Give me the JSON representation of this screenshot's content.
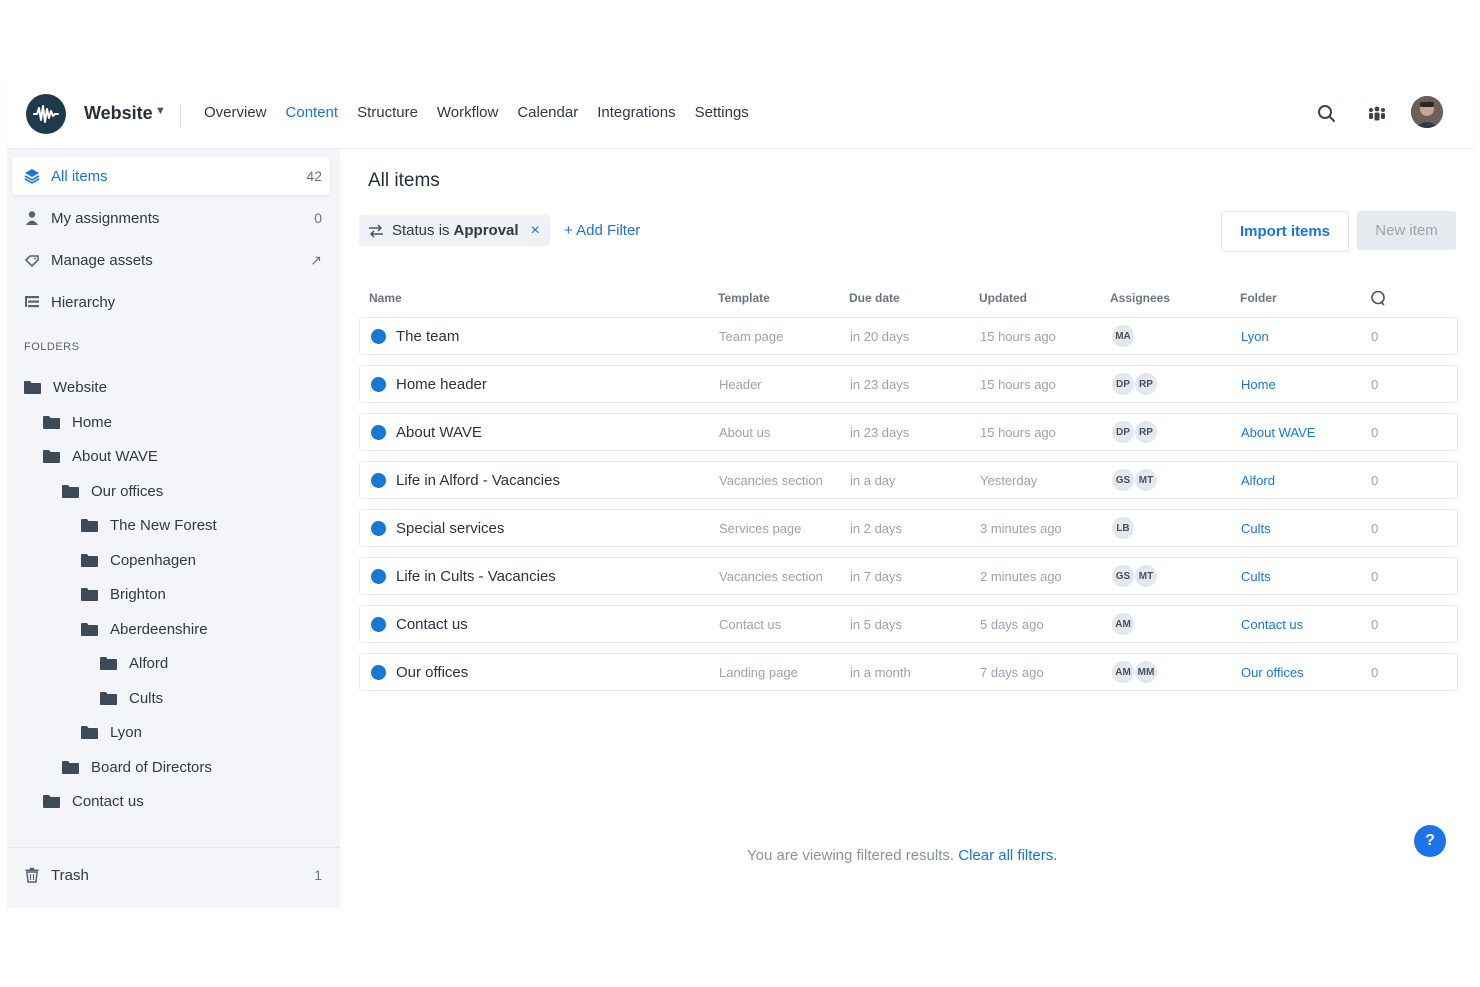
{
  "header": {
    "site_name": "Website",
    "nav": [
      "Overview",
      "Content",
      "Structure",
      "Workflow",
      "Calendar",
      "Integrations",
      "Settings"
    ],
    "active_nav": "Content",
    "accent": "#1976d2"
  },
  "sidebar": {
    "items": [
      {
        "label": "All items",
        "count": "42",
        "icon": "stack-icon"
      },
      {
        "label": "My assignments",
        "count": "0",
        "icon": "person-icon"
      },
      {
        "label": "Manage assets",
        "count": "↗",
        "icon": "assets-icon"
      },
      {
        "label": "Hierarchy",
        "count": "",
        "icon": "hierarchy-icon"
      }
    ],
    "folders_header": "FOLDERS",
    "folders": [
      "Website",
      "Home",
      "About WAVE",
      "Our offices",
      "The New Forest",
      "Copenhagen",
      "Brighton",
      "Aberdeenshire",
      "Alford",
      "Cults",
      "Lyon",
      "Board of Directors",
      "Contact us"
    ],
    "trash_label": "Trash",
    "trash_count": "1"
  },
  "main": {
    "title": "All items",
    "filter": {
      "prefix": "Status is",
      "value": "Approval",
      "remove": "×"
    },
    "add_filter": "+ Add Filter",
    "import_button": "Import items",
    "new_button": "New item",
    "columns": [
      "Name",
      "Template",
      "Due date",
      "Updated",
      "Assignees",
      "Folder"
    ],
    "rows": [
      {
        "name": "The team",
        "template": "Team page",
        "due": "in 20 days",
        "updated": "15 hours ago",
        "assignees": [
          "MA"
        ],
        "folder": "Lyon",
        "comments": "0"
      },
      {
        "name": "Home header",
        "template": "Header",
        "due": "in 23 days",
        "updated": "15 hours ago",
        "assignees": [
          "DP",
          "RP"
        ],
        "folder": "Home",
        "comments": "0"
      },
      {
        "name": "About WAVE",
        "template": "About us",
        "due": "in 23 days",
        "updated": "15 hours ago",
        "assignees": [
          "DP",
          "RP"
        ],
        "folder": "About WAVE",
        "comments": "0"
      },
      {
        "name": "Life in Alford - Vacancies",
        "template": "Vacancies section",
        "due": "in a day",
        "updated": "Yesterday",
        "assignees": [
          "GS",
          "MT"
        ],
        "folder": "Alford",
        "comments": "0"
      },
      {
        "name": "Special services",
        "template": "Services page",
        "due": "in 2 days",
        "updated": "3 minutes ago",
        "assignees": [
          "LB"
        ],
        "folder": "Cults",
        "comments": "0"
      },
      {
        "name": "Life in Cults - Vacancies",
        "template": "Vacancies section",
        "due": "in 7 days",
        "updated": "2 minutes ago",
        "assignees": [
          "GS",
          "MT"
        ],
        "folder": "Cults",
        "comments": "0"
      },
      {
        "name": "Contact us",
        "template": "Contact us",
        "due": "in 5 days",
        "updated": "5 days ago",
        "assignees": [
          "AM"
        ],
        "folder": "Contact us",
        "comments": "0"
      },
      {
        "name": "Our offices",
        "template": "Landing page",
        "due": "in a month",
        "updated": "7 days ago",
        "assignees": [
          "AM",
          "MM"
        ],
        "folder": "Our offices",
        "comments": "0"
      }
    ],
    "footer_text": "You are viewing filtered results.",
    "footer_link": "Clear all filters.",
    "help": "?"
  }
}
